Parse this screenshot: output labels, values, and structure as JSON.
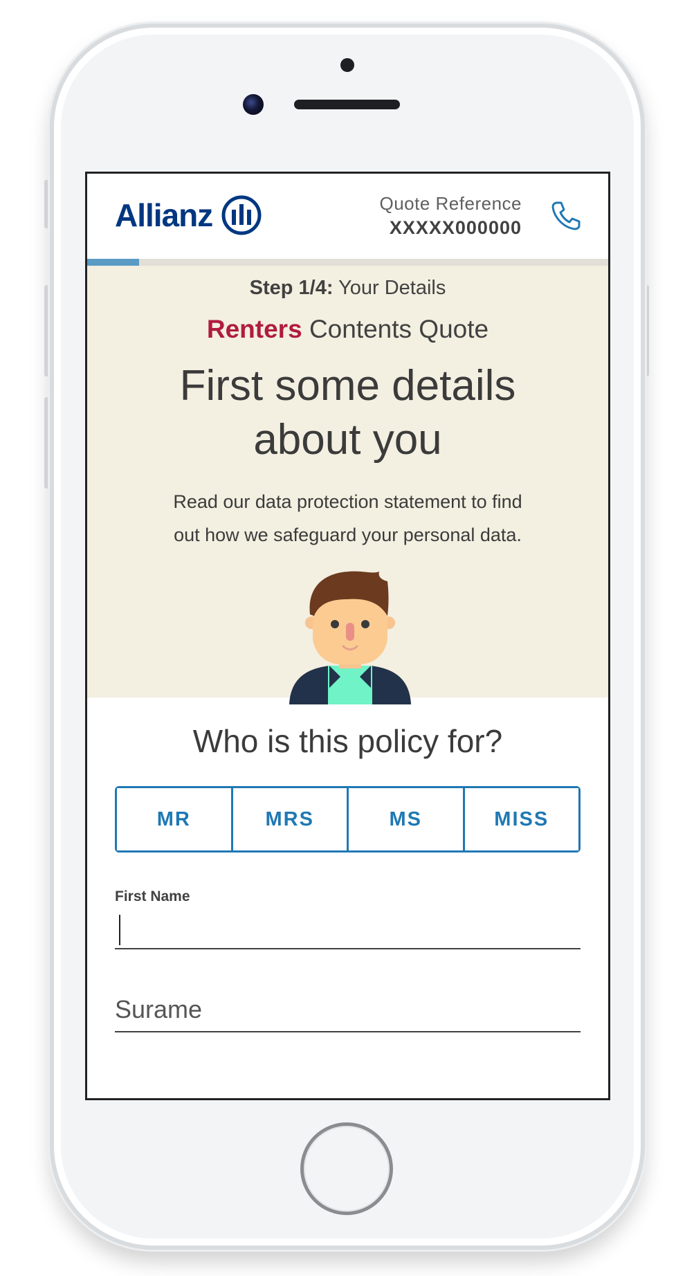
{
  "header": {
    "logo_text": "Allianz",
    "quote_ref_label": "Quote Reference",
    "quote_ref_value": "XXXXX000000"
  },
  "progress": {
    "fraction": 0.1
  },
  "hero": {
    "step_bold": "Step 1/4:",
    "step_text": "Your Details",
    "product_brand": "Renters",
    "product_rest": "Contents Quote",
    "headline_line1": "First some details",
    "headline_line2": "about you",
    "lede_line1": "Read our data protection statement to find",
    "lede_line2": "out how we safeguard your personal data."
  },
  "form": {
    "question": "Who is this policy for?",
    "titles": [
      "MR",
      "MRS",
      "MS",
      "MISS"
    ],
    "first_name_label": "First Name",
    "first_name_value": "",
    "surname_placeholder": "Surame"
  },
  "colors": {
    "brand_blue": "#003781",
    "accent_blue": "#1f78b4",
    "brand_red": "#b01c3c",
    "hero_bg": "#f3efe1",
    "progress_fill": "#5a9bc6"
  }
}
